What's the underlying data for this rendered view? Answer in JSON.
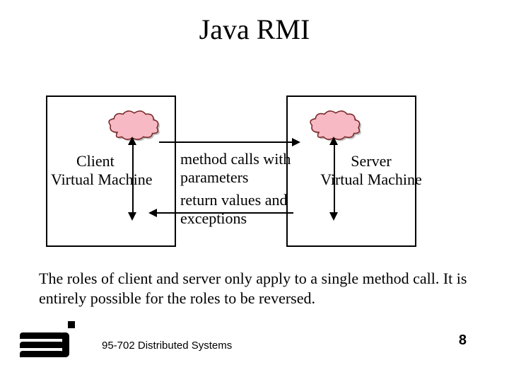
{
  "title": "Java RMI",
  "client": {
    "line1": "Client",
    "line2": "Virtual Machine"
  },
  "server": {
    "line1": "Server",
    "line2": "Virtual Machine"
  },
  "mid": {
    "top": "method calls with parameters",
    "bottom": "return values and exceptions"
  },
  "caption": "The roles of client and server only apply to a single method call. It is entirely possible for the roles to be reversed.",
  "footer": "95-702 Distributed Systems",
  "page": "8",
  "colors": {
    "cloud_fill": "#f7b9c4",
    "cloud_stroke": "#7a2a2a"
  }
}
